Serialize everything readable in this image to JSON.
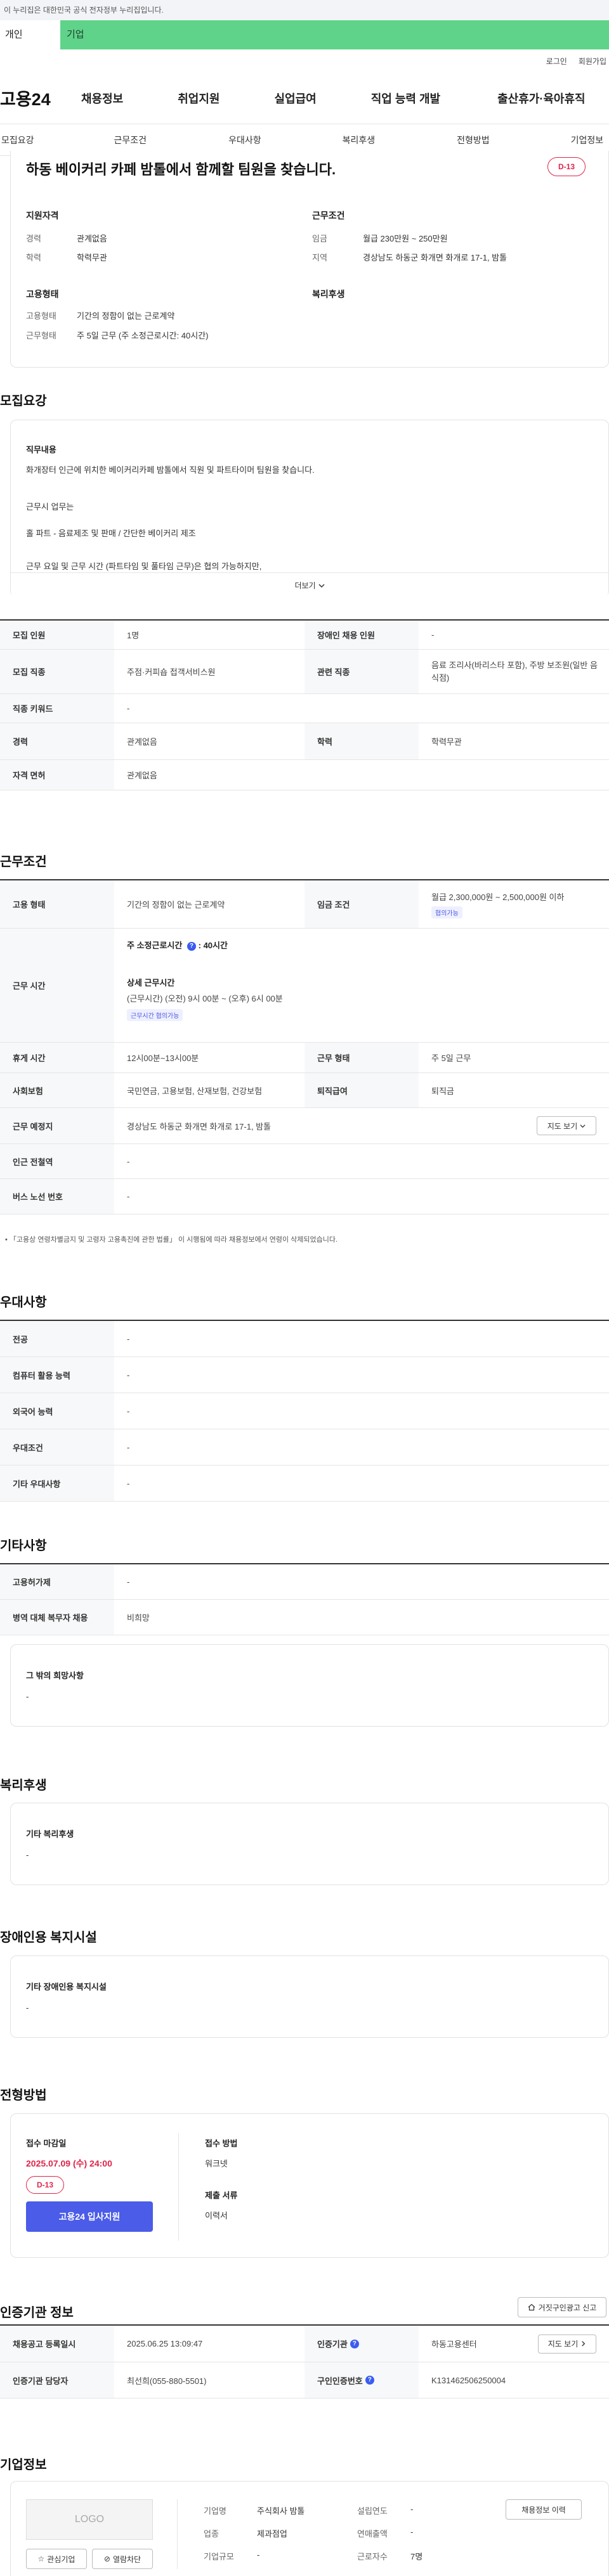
{
  "gov_banner": "이 누리집은 대한민국 공식 전자정부 누리집입니다.",
  "top_tabs": {
    "personal": "개인",
    "company": "기업"
  },
  "util_links": {
    "login": "로그인",
    "signup": "회원가입"
  },
  "gnb": {
    "logo": "고용24",
    "items": [
      "채용정보",
      "취업지원",
      "실업급여",
      "직업 능력 개발",
      "출산휴가·육아휴직"
    ]
  },
  "subnav": [
    "모집요강",
    "근무조건",
    "우대사항",
    "복리후생",
    "전형방법",
    "기업정보"
  ],
  "summary": {
    "title": "하동 베이커리 카페 밤톨에서 함께할 팀원을 찾습니다.",
    "dday": "D-13",
    "qual_title": "지원자격",
    "career_label": "경력",
    "career_value": "관계없음",
    "edu_label": "학력",
    "edu_value": "학력무관",
    "cond_title": "근무조건",
    "wage_label": "임금",
    "wage_value": "월급 230만원 ~ 250만원",
    "region_label": "지역",
    "region_value": "경상남도 하동군 화개면 화개로 17-1, 밤톨",
    "emp_title": "고용형태",
    "emp_type_label": "고용형태",
    "emp_type_value": "기간의 정함이 없는 근로계약",
    "work_label": "근무형태",
    "work_value": "주 5일 근무 (주 소정근로시간: 40시간)",
    "welfare_title": "복리후생"
  },
  "recruit": {
    "heading": "모집요강",
    "job_title": "직무내용",
    "job_lines": [
      "화개장터 인근에 위치한 베이커리카페 밤톨에서 직원 및 파트타이머 팀원을 찾습니다.",
      "근무시 업무는",
      "홀 파트 - 음료제조 및 판매 / 간단한 베이커리 제조",
      "근무 요일 및 근무 시간 (파트타임 및 풀타임 근무)은 협의 가능하지만,"
    ],
    "more": "더보기",
    "rows": [
      {
        "k1": "모집 인원",
        "v1": "1명",
        "k2": "장애인 채용 인원",
        "v2": "-"
      },
      {
        "k1": "모집 직종",
        "v1": "주점·커피숍 접객서비스원",
        "k2": "관련 직종",
        "v2": "음료 조리사(바리스타 포함), 주방 보조원(일반 음식점)"
      },
      {
        "k1": "직종 키워드",
        "v1": "-"
      },
      {
        "k1": "경력",
        "v1": "관계없음",
        "k2": "학력",
        "v2": "학력무관"
      },
      {
        "k1": "자격 면허",
        "v1": "관계없음"
      }
    ]
  },
  "conditions": {
    "heading": "근무조건",
    "emp_type_label": "고용 형태",
    "emp_type_value": "기간의 정함이 없는 근로계약",
    "wage_label": "임금 조건",
    "wage_value": "월급 2,300,000원 ~ 2,500,000원 이하",
    "wage_badge": "협의가능",
    "hours_label": "근무 시간",
    "weekly_hours_label": "주 소정근로시간",
    "weekly_hours_value": "40시간",
    "detail_hours_label": "상세 근무시간",
    "detail_hours_value": "(근무시간) (오전) 9시 00분 ~ (오후) 6시 00분",
    "hours_badge": "근무시간 협의가능",
    "break_label": "휴게 시간",
    "break_value": "12시00분~13시00분",
    "shift_label": "근무 형태",
    "shift_value": "주 5일 근무",
    "insurance_label": "사회보험",
    "insurance_value": "국민연금, 고용보험, 산재보험, 건강보험",
    "severance_label": "퇴직급여",
    "severance_value": "퇴직금",
    "location_label": "근무 예정지",
    "location_value": "경상남도 하동군 화개면 화개로 17-1, 밤톨",
    "map_btn": "지도 보기",
    "station_label": "인근 전철역",
    "station_value": "-",
    "bus_label": "버스 노선 번호",
    "bus_value": "-",
    "note": "「고용상 연령차별금지 및 고령자 고용촉진에 관한 법률」 이 시행됨에 따라 채용정보에서 연령이 삭제되었습니다."
  },
  "preference": {
    "heading": "우대사항",
    "rows": [
      {
        "k": "전공",
        "v": "-"
      },
      {
        "k": "컴퓨터 활용 능력",
        "v": "-"
      },
      {
        "k": "외국어 능력",
        "v": "-"
      },
      {
        "k": "우대조건",
        "v": "-"
      },
      {
        "k": "기타 우대사항",
        "v": "-"
      }
    ]
  },
  "etc": {
    "heading": "기타사항",
    "rows": [
      {
        "k": "고용허가제",
        "v": "-"
      },
      {
        "k": "병역 대체 복무자 채용",
        "v": "비희망"
      }
    ],
    "other_title": "그 밖의 희망사항",
    "other_value": "-"
  },
  "welfare": {
    "heading": "복리후생",
    "box_title": "기타 복리후생",
    "box_value": "-"
  },
  "disability": {
    "heading": "장애인용 복지시설",
    "box_title": "기타 장애인용 복지시설",
    "box_value": "-"
  },
  "selection": {
    "heading": "전형방법",
    "deadline_label": "접수 마감일",
    "deadline_value": "2025.07.09 (수) 24:00",
    "dday": "D-13",
    "apply_btn": "고용24 입사지원",
    "method_label": "접수 방법",
    "method_value": "워크넷",
    "docs_label": "제출 서류",
    "docs_value": "이력서"
  },
  "agency": {
    "heading": "인증기관 정보",
    "report_btn": "거짓구인광고 신고",
    "reg_label": "채용공고 등록일시",
    "reg_value": "2025.06.25 13:09:47",
    "agency_label": "인증기관",
    "agency_value": "하동고용센터",
    "map_btn": "지도 보기",
    "manager_label": "인증기관 담당자",
    "manager_value": "최선희(055-880-5501)",
    "jobno_label": "구인인증번호",
    "jobno_value": "K131462506250004"
  },
  "company": {
    "heading": "기업정보",
    "logo": "LOGO",
    "fav_btn": "관심기업",
    "block_btn": "열람차단",
    "name_label": "기업명",
    "name_value": "주식회사 밤톨",
    "industry_label": "업종",
    "industry_value": "제과점업",
    "size_label": "기업규모",
    "size_value": "-",
    "founded_label": "설립연도",
    "founded_value": "-",
    "revenue_label": "연매출액",
    "revenue_value": "-",
    "employees_label": "근로자수",
    "employees_value": "7명",
    "history_btn": "채용정보 이력"
  },
  "colors": {
    "accent": "#4a5ce8",
    "dday": "#e0244a",
    "company_tab": "#5fd38a"
  }
}
